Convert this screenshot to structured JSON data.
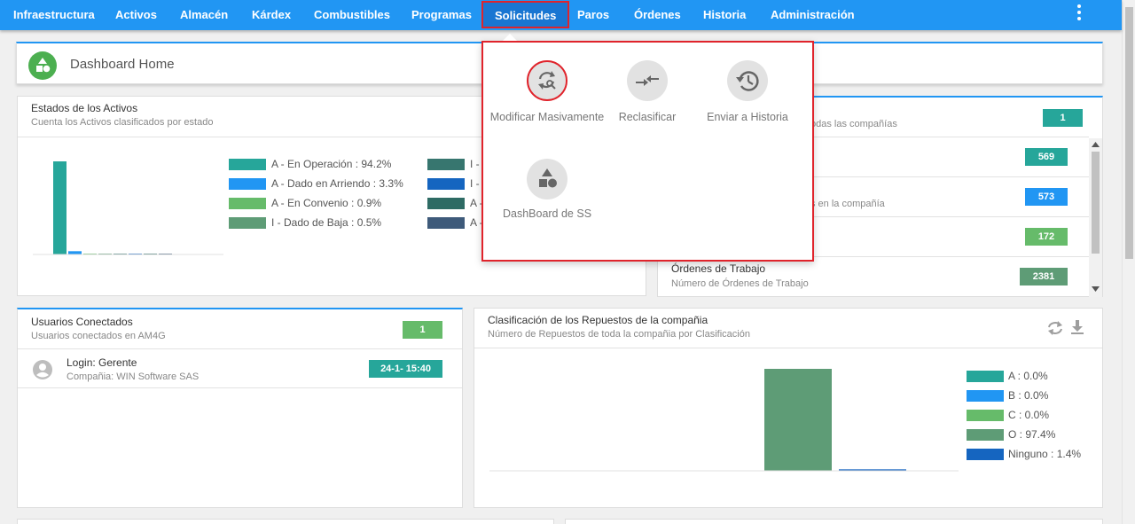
{
  "nav": {
    "items": [
      "Infraestructura",
      "Activos",
      "Almacén",
      "Kárdex",
      "Combustibles",
      "Programas",
      "Solicitudes",
      "Paros",
      "Órdenes",
      "Historia",
      "Administración"
    ],
    "active": "Solicitudes"
  },
  "dashboard": {
    "title": "Dashboard Home"
  },
  "estados": {
    "title": "Estados de los Activos",
    "subtitle": "Cuenta los Activos clasificados por estado",
    "legend": [
      {
        "label": "A - En Operación : 94.2%",
        "color": "#26a69a"
      },
      {
        "label": "A - Dado en Arriendo : 3.3%",
        "color": "#2196f3"
      },
      {
        "label": "A - En Convenio : 0.9%",
        "color": "#66bb6a"
      },
      {
        "label": "I - Dado de Baja : 0.5%",
        "color": "#5e9c76"
      },
      {
        "label": "I -",
        "color": "#37766f"
      },
      {
        "label": "I -",
        "color": "#1565c0"
      },
      {
        "label": "A -",
        "color": "#2e6b64"
      },
      {
        "label": "A -",
        "color": "#3e5a7a"
      }
    ]
  },
  "companias": {
    "partial_subtitle": "odas las compañías",
    "badge": "1",
    "rows": [
      {
        "title": "",
        "subtitle": "",
        "badge": "569",
        "color": "#26a69a"
      },
      {
        "title": "",
        "subtitle": "s en la compañía",
        "badge": "573",
        "color": "#2196f3"
      },
      {
        "title": "",
        "subtitle": "",
        "badge": "172",
        "color": "#66bb6a"
      },
      {
        "title": "Órdenes de Trabajo",
        "subtitle": "Número de Órdenes de Trabajo",
        "badge": "2381",
        "color": "#5e9c76"
      }
    ]
  },
  "usuarios": {
    "title": "Usuarios Conectados",
    "subtitle": "Usuarios conectados en AM4G",
    "badge": "1",
    "user": {
      "login": "Login: Gerente",
      "company": "Compañia: WIN Software SAS",
      "time": "24-1- 15:40"
    }
  },
  "repuestos": {
    "title": "Clasificación de los Repuestos de la compañia",
    "subtitle": "Número de Repuestos de toda la compañia por Clasificación",
    "icons": [
      "refresh-icon",
      "download-icon"
    ]
  },
  "menu": {
    "items": [
      {
        "label": "Modificar Masivamente",
        "icon": "refresh-search-icon"
      },
      {
        "label": "Reclasificar",
        "icon": "swap-arrows-icon"
      },
      {
        "label": "Enviar a Historia",
        "icon": "history-icon"
      },
      {
        "label": "DashBoard de SS",
        "icon": "shapes-icon"
      }
    ]
  },
  "chart_data": [
    {
      "type": "bar",
      "title": "Estados de los Activos",
      "categories": [
        "A - En Operación",
        "A - Dado en Arriendo",
        "A - En Convenio",
        "I - Dado de Baja",
        "I -",
        "I -",
        "A -",
        "A -"
      ],
      "values": [
        94.2,
        3.3,
        0.9,
        0.5,
        0.4,
        0.3,
        0.2,
        0.2
      ],
      "colors": [
        "#26a69a",
        "#2196f3",
        "#66bb6a",
        "#5e9c76",
        "#37766f",
        "#1565c0",
        "#2e6b64",
        "#3e5a7a"
      ]
    },
    {
      "type": "bar",
      "title": "Clasificación de los Repuestos de la compañia",
      "categories": [
        "A",
        "B",
        "C",
        "O",
        "Ninguno"
      ],
      "values": [
        0.0,
        0.0,
        0.0,
        97.4,
        1.4
      ],
      "legend": [
        "A : 0.0%",
        "B : 0.0%",
        "C : 0.0%",
        "O : 97.4%",
        "Ninguno : 1.4%"
      ],
      "colors": [
        "#26a69a",
        "#2196f3",
        "#66bb6a",
        "#5e9c76",
        "#1565c0"
      ]
    }
  ]
}
